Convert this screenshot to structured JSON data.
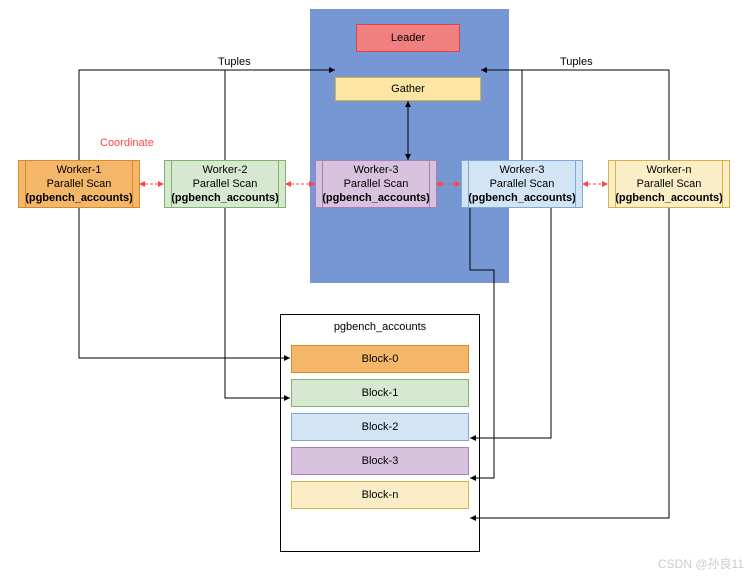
{
  "labels": {
    "tuples": "Tuples",
    "coordinate": "Coordinate"
  },
  "leader": {
    "label": "Leader"
  },
  "gather": {
    "label": "Gather"
  },
  "workers": [
    {
      "title": "Worker-1",
      "line2": "Parallel Scan",
      "table": "(pgbench_accounts)"
    },
    {
      "title": "Worker-2",
      "line2": "Parallel Scan",
      "table": "(pgbench_accounts)"
    },
    {
      "title": "Worker-3",
      "line2": "Parallel Scan",
      "table": "(pgbench_accounts)"
    },
    {
      "title": "Worker-3",
      "line2": "Parallel Scan",
      "table": "(pgbench_accounts)"
    },
    {
      "title": "Worker-n",
      "line2": "Parallel Scan",
      "table": "(pgbench_accounts)"
    }
  ],
  "table": {
    "name": "pgbench_accounts",
    "blocks": [
      "Block-0",
      "Block-1",
      "Block-2",
      "Block-3",
      "Block-n"
    ]
  },
  "colors": {
    "leader_bg": "#f08080",
    "leader_bd": "#d94646",
    "gather_bg": "#fbe7a3",
    "gather_bd": "#d6b24a",
    "w1_bg": "#f4b76a",
    "w1_bd": "#d68b2e",
    "w2_bg": "#d6e9d0",
    "w2_bd": "#7fb36e",
    "w3_bg": "#d7c3de",
    "w3_bd": "#a87fb8",
    "w4_bg": "#d3e4f5",
    "w4_bd": "#7ea8d6",
    "w5_bg": "#fbeec6",
    "w5_bd": "#d6b24a",
    "b0_bg": "#f4b76a",
    "b0_bd": "#d68b2e",
    "b1_bg": "#d6e9d0",
    "b1_bd": "#7fb36e",
    "b2_bg": "#d3e4f5",
    "b2_bd": "#7ea8d6",
    "b3_bg": "#d7c3de",
    "b3_bd": "#a87fb8",
    "bn_bg": "#fbeec6",
    "bn_bd": "#d6b24a"
  },
  "watermark": "CSDN @孙良11"
}
